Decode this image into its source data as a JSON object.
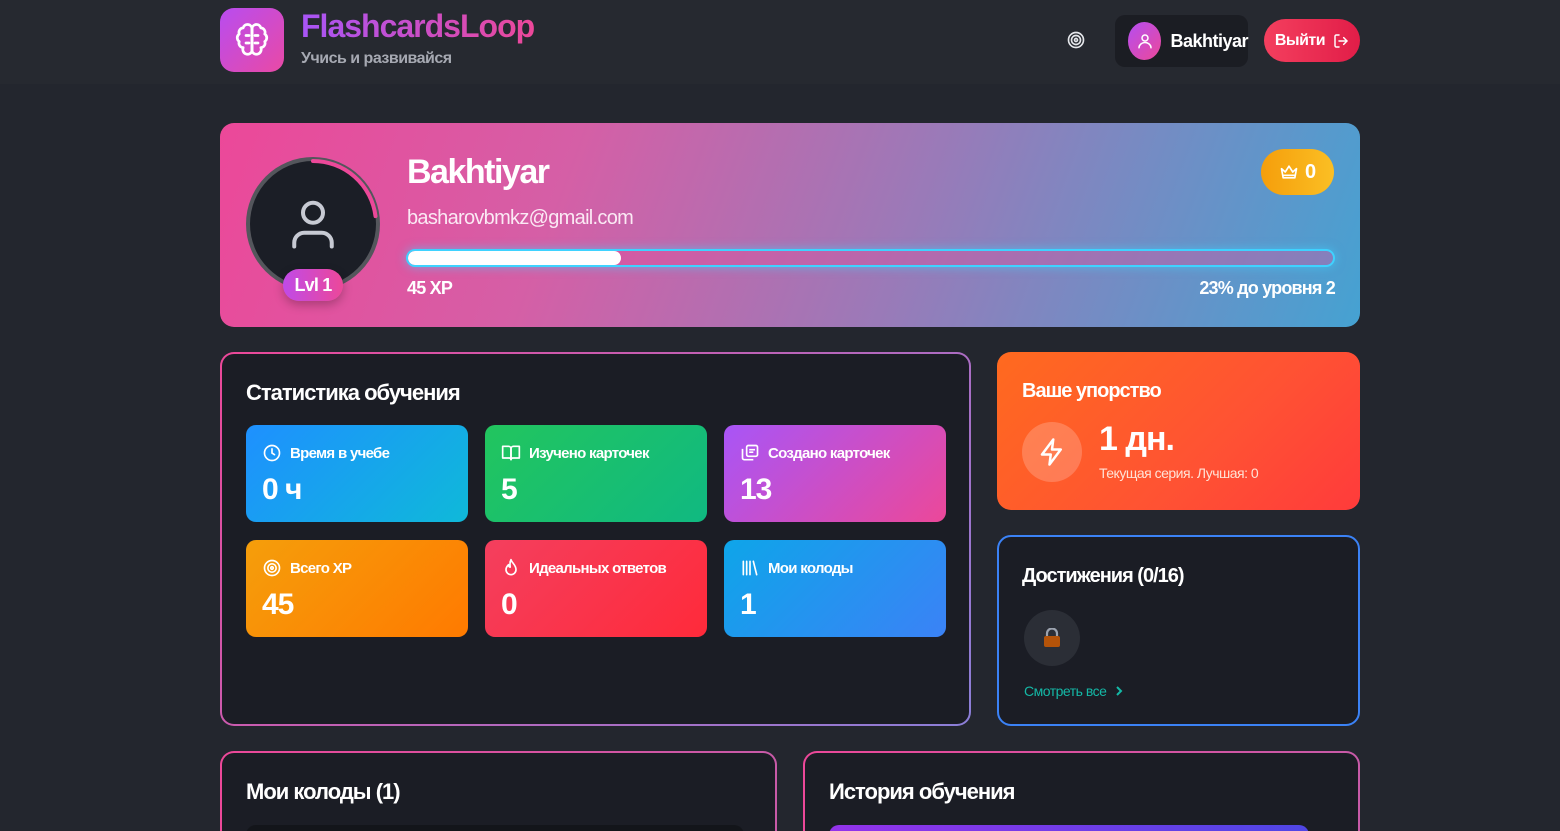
{
  "header": {
    "brand": "FlashcardsLoop",
    "tagline": "Учись и развивайся",
    "user_name": "Bakhtiyar",
    "logout_label": "Выйти"
  },
  "profile": {
    "name": "Bakhtiyar",
    "email": "basharovbmkz@gmail.com",
    "level_badge": "Lvl 1",
    "xp_text": "45 XP",
    "next_level_text": "23% до уровня 2",
    "progress_fraction": 0.23,
    "crown_count": "0"
  },
  "stats": {
    "title": "Статистика обучения",
    "tiles": [
      {
        "label": "Время в учебе",
        "value": "0 ч",
        "icon": "clock-icon"
      },
      {
        "label": "Изучено карточек",
        "value": "5",
        "icon": "book-icon"
      },
      {
        "label": "Создано карточек",
        "value": "13",
        "icon": "cards-icon"
      },
      {
        "label": "Всего XP",
        "value": "45",
        "icon": "target-icon"
      },
      {
        "label": "Идеальных ответов",
        "value": "0",
        "icon": "flame-icon"
      },
      {
        "label": "Мои колоды",
        "value": "1",
        "icon": "library-icon"
      }
    ]
  },
  "streak": {
    "title": "Ваше упорство",
    "value": "1 дн.",
    "subtitle": "Текущая серия. Лучшая: 0"
  },
  "achievements": {
    "title": "Достижения (0/16)",
    "see_all": "Смотреть все"
  },
  "decks": {
    "title": "Мои колоды (1)"
  },
  "history": {
    "title": "История обучения"
  },
  "colors": {
    "background": "#23262e",
    "accent_pink": "#ec4899",
    "accent_purple": "#a855f7",
    "logout_red": "#f43f5e",
    "streak_orange": "#ff5a2a",
    "achievements_border": "#3b82f6"
  }
}
